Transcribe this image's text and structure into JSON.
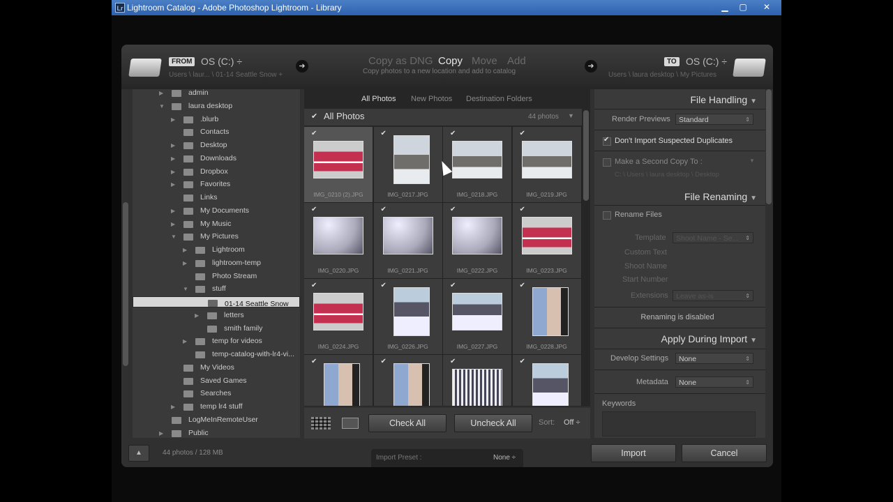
{
  "window": {
    "title": "Lightroom Catalog - Adobe Photoshop Lightroom - Library",
    "app_badge": "Lr"
  },
  "source": {
    "tag": "FROM",
    "drive": "OS (C:) ÷",
    "path": "Users \\ laur... \\ 01-14 Seattle Snow +"
  },
  "modes": {
    "dng": "Copy as DNG",
    "copy": "Copy",
    "move": "Move",
    "add": "Add",
    "subtitle": "Copy photos to a new location and add to catalog"
  },
  "destination": {
    "tag": "TO",
    "drive": "OS (C:) ÷",
    "path": "Users \\ laura desktop \\ My Pictures"
  },
  "folders": [
    {
      "label": "admin",
      "indent": 0,
      "tri": "▶"
    },
    {
      "label": "laura desktop",
      "indent": 0,
      "tri": "▼"
    },
    {
      "label": ".blurb",
      "indent": 1,
      "tri": "▶"
    },
    {
      "label": "Contacts",
      "indent": 1,
      "tri": ""
    },
    {
      "label": "Desktop",
      "indent": 1,
      "tri": "▶"
    },
    {
      "label": "Downloads",
      "indent": 1,
      "tri": "▶"
    },
    {
      "label": "Dropbox",
      "indent": 1,
      "tri": "▶"
    },
    {
      "label": "Favorites",
      "indent": 1,
      "tri": "▶"
    },
    {
      "label": "Links",
      "indent": 1,
      "tri": ""
    },
    {
      "label": "My Documents",
      "indent": 1,
      "tri": "▶"
    },
    {
      "label": "My Music",
      "indent": 1,
      "tri": "▶"
    },
    {
      "label": "My Pictures",
      "indent": 1,
      "tri": "▼"
    },
    {
      "label": "Lightroom",
      "indent": 2,
      "tri": "▶"
    },
    {
      "label": "lightroom-temp",
      "indent": 2,
      "tri": "▶"
    },
    {
      "label": "Photo Stream",
      "indent": 2,
      "tri": ""
    },
    {
      "label": "stuff",
      "indent": 2,
      "tri": "▼"
    },
    {
      "label": "01-14 Seattle Snow",
      "indent": 3,
      "tri": "",
      "selected": true
    },
    {
      "label": "letters",
      "indent": 3,
      "tri": "▶"
    },
    {
      "label": "smith family",
      "indent": 3,
      "tri": ""
    },
    {
      "label": "temp for videos",
      "indent": 2,
      "tri": "▶"
    },
    {
      "label": "temp-catalog-with-lr4-vi...",
      "indent": 2,
      "tri": ""
    },
    {
      "label": "My Videos",
      "indent": 1,
      "tri": ""
    },
    {
      "label": "Saved Games",
      "indent": 1,
      "tri": ""
    },
    {
      "label": "Searches",
      "indent": 1,
      "tri": ""
    },
    {
      "label": "temp lr4 stuff",
      "indent": 1,
      "tri": "▶"
    },
    {
      "label": "LogMeInRemoteUser",
      "indent": 0,
      "tri": ""
    },
    {
      "label": "Public",
      "indent": 0,
      "tri": "▶"
    }
  ],
  "grid_tabs": {
    "all": "All Photos",
    "new": "New Photos",
    "dest": "Destination Folders"
  },
  "grid_header": {
    "title": "All Photos",
    "count": "44 photos"
  },
  "photos": [
    {
      "name": "IMG_0210 (2).JPG",
      "style": "t-red",
      "orient": "land",
      "dim": true
    },
    {
      "name": "IMG_0217.JPG",
      "style": "t-snow",
      "orient": "port"
    },
    {
      "name": "IMG_0218.JPG",
      "style": "t-snow",
      "orient": "land"
    },
    {
      "name": "IMG_0219.JPG",
      "style": "t-snow",
      "orient": "land"
    },
    {
      "name": "IMG_0220.JPG",
      "style": "t-branch",
      "orient": "land"
    },
    {
      "name": "IMG_0221.JPG",
      "style": "t-branch",
      "orient": "land"
    },
    {
      "name": "IMG_0222.JPG",
      "style": "t-branch",
      "orient": "land"
    },
    {
      "name": "IMG_0223.JPG",
      "style": "t-red",
      "orient": "land"
    },
    {
      "name": "IMG_0224.JPG",
      "style": "t-red",
      "orient": "land"
    },
    {
      "name": "IMG_0226.JPG",
      "style": "t-path",
      "orient": "port"
    },
    {
      "name": "IMG_0227.JPG",
      "style": "t-path",
      "orient": "land"
    },
    {
      "name": "IMG_0228.JPG",
      "style": "t-face",
      "orient": "port"
    },
    {
      "name": "",
      "style": "t-face",
      "orient": "port"
    },
    {
      "name": "",
      "style": "t-face",
      "orient": "port"
    },
    {
      "name": "",
      "style": "t-fence",
      "orient": "land"
    },
    {
      "name": "",
      "style": "t-path",
      "orient": "port"
    }
  ],
  "grid_footer": {
    "check_all": "Check All",
    "uncheck_all": "Uncheck All",
    "sort_label": "Sort:",
    "sort_value": "Off ÷"
  },
  "file_handling": {
    "title": "File Handling",
    "render_label": "Render Previews",
    "render_value": "Standard",
    "dup_label": "Don't Import Suspected Duplicates",
    "second_copy_label": "Make a Second Copy To :",
    "second_copy_path": "C: \\ Users \\ laura desktop \\ Desktop"
  },
  "file_renaming": {
    "title": "File Renaming",
    "rename_label": "Rename Files",
    "template_label": "Template",
    "template_value": "Shoot Name - Se...",
    "custom_text": "Custom Text",
    "shoot_name": "Shoot Name",
    "start_number": "Start Number",
    "extensions_label": "Extensions",
    "extensions_value": "Leave as-is",
    "disabled_msg": "Renaming is disabled"
  },
  "apply_import": {
    "title": "Apply During Import",
    "develop_label": "Develop Settings",
    "develop_value": "None",
    "metadata_label": "Metadata",
    "metadata_value": "None",
    "keywords_label": "Keywords"
  },
  "bottom": {
    "summary": "44 photos / 128 MB",
    "preset_label": "Import Preset :",
    "preset_value": "None ÷",
    "import": "Import",
    "cancel": "Cancel"
  }
}
